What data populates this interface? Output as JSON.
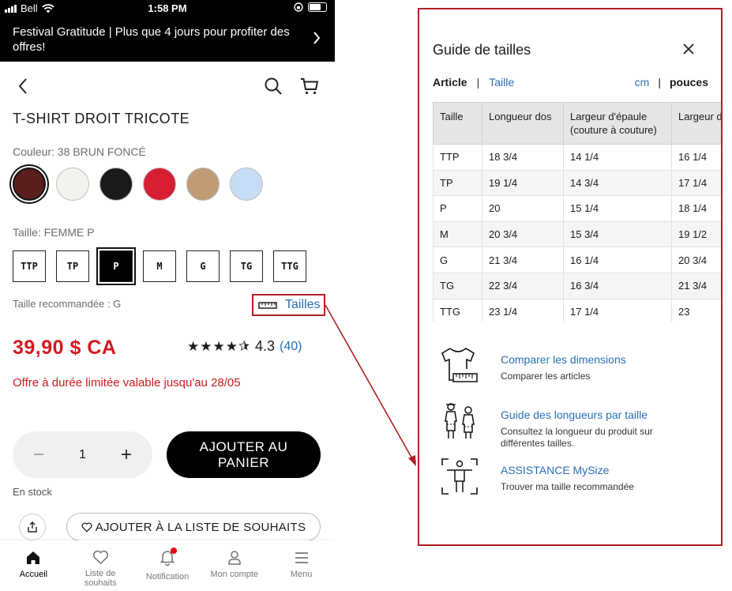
{
  "status_bar": {
    "carrier": "Bell",
    "time": "1:58 PM"
  },
  "promo_banner": {
    "text": "Festival Gratitude | Plus que 4 jours pour profiter des offres!"
  },
  "product": {
    "title": "T-SHIRT DROIT TRICOTE",
    "color_label": "Couleur: 38 BRUN FONCÉ",
    "colors": [
      "#5a1e1e",
      "#f4f2ee",
      "#1a1a1a",
      "#d81e32",
      "#c19b74",
      "#c7dcf5"
    ],
    "selected_color_index": 0,
    "size_label": "Taille: FEMME P",
    "sizes": [
      "TTP",
      "TP",
      "P",
      "M",
      "G",
      "TG",
      "TTG"
    ],
    "selected_size": "P",
    "recommended": "Taille recommandée : G",
    "size_guide_link": "Tailles",
    "price": "39,90 $ CA",
    "rating": {
      "stars": "★★★★",
      "score": "4.3",
      "count": "(40)",
      "value": 4.3
    },
    "offer": "Offre à durée limitée valable jusqu'au 28/05",
    "quantity": "1",
    "add_to_cart": "AJOUTER AU PANIER",
    "stock": "En stock",
    "wishlist": "AJOUTER À LA LISTE DE SOUHAITS"
  },
  "tabbar": [
    {
      "label": "Accueil",
      "icon": "home-icon",
      "active": true
    },
    {
      "label": "Liste de souhaits",
      "icon": "heart-icon"
    },
    {
      "label": "Notification",
      "icon": "bell-icon"
    },
    {
      "label": "Mon compte",
      "icon": "user-icon"
    },
    {
      "label": "Menu",
      "icon": "menu-icon"
    }
  ],
  "size_guide": {
    "title": "Guide de tailles",
    "tabs": {
      "active": "Article",
      "inactive": "Taille"
    },
    "units": {
      "inactive": "cm",
      "active": "pouces"
    },
    "headers": [
      "Taille",
      "Longueur dos",
      "Largeur d'épaule (couture à couture)",
      "Largeur d"
    ],
    "rows": [
      [
        "TTP",
        "18 3/4",
        "14 1/4",
        "16 1/4"
      ],
      [
        "TP",
        "19 1/4",
        "14 3/4",
        "17 1/4"
      ],
      [
        "P",
        "20",
        "15 1/4",
        "18 1/4"
      ],
      [
        "M",
        "20 3/4",
        "15 3/4",
        "19 1/2"
      ],
      [
        "G",
        "21 3/4",
        "16 1/4",
        "20 3/4"
      ],
      [
        "TG",
        "22 3/4",
        "16 3/4",
        "21 3/4"
      ],
      [
        "TTG",
        "23 1/4",
        "17 1/4",
        "23"
      ]
    ],
    "links": [
      {
        "title": "Comparer les dimensions",
        "desc": "Comparer les articles"
      },
      {
        "title": "Guide des longueurs par taille",
        "desc": "Consultez la longueur du produit sur différentes tailles."
      },
      {
        "title": "ASSISTANCE MySize",
        "desc": "Trouver ma taille recommandée"
      }
    ]
  },
  "colors": {
    "price_red": "#d11a1f",
    "link_blue": "#2a6fb3",
    "callout_red": "#b01f24"
  }
}
